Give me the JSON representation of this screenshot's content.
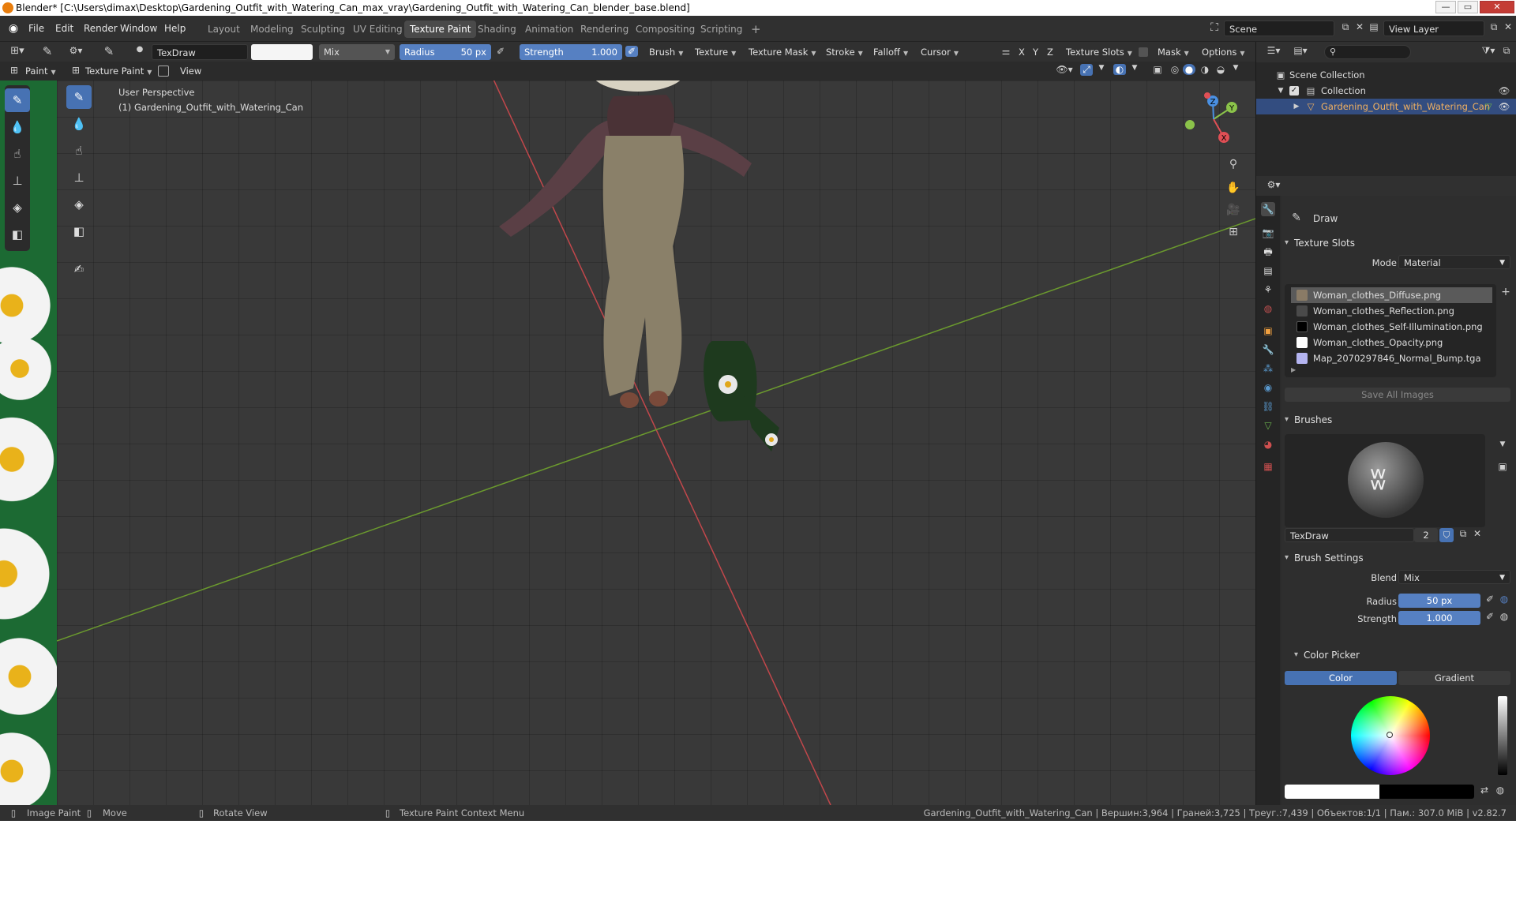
{
  "window": {
    "title": "Blender* [C:\\Users\\dimax\\Desktop\\Gardening_Outfit_with_Watering_Can_max_vray\\Gardening_Outfit_with_Watering_Can_blender_base.blend]",
    "minimize": "—",
    "maximize": "▭",
    "close": "✕"
  },
  "menu": {
    "items": [
      "File",
      "Edit",
      "Render",
      "Window",
      "Help"
    ]
  },
  "workspaces": [
    "Layout",
    "Modeling",
    "Sculpting",
    "UV Editing",
    "Texture Paint",
    "Shading",
    "Animation",
    "Rendering",
    "Compositing",
    "Scripting"
  ],
  "workspace_add": "+",
  "scene": {
    "label": "Scene",
    "view_layer": "View Layer"
  },
  "tool_header": {
    "brush_name": "TexDraw",
    "blend": "Mix",
    "radius_label": "Radius",
    "radius_value": "50 px",
    "strength_label": "Strength",
    "strength_value": "1.000",
    "menus": [
      "Brush",
      "Texture",
      "Texture Mask",
      "Stroke",
      "Falloff",
      "Cursor"
    ],
    "axes": [
      "X",
      "Y",
      "Z"
    ],
    "texture_slots": "Texture Slots",
    "mask": "Mask",
    "options": "Options"
  },
  "view_header": {
    "paint": "Paint",
    "mode": "Texture Paint",
    "view": "View"
  },
  "viewport": {
    "perspective": "User Perspective",
    "object": "(1) Gardening_Outfit_with_Watering_Can",
    "gizmo": {
      "x": "X",
      "y": "Y",
      "z": "Z"
    }
  },
  "outliner": {
    "scene_collection": "Scene Collection",
    "collection": "Collection",
    "object": "Gardening_Outfit_with_Watering_Can"
  },
  "properties": {
    "tool_name": "Draw",
    "texture_slots": {
      "title": "Texture Slots",
      "mode_label": "Mode",
      "mode_value": "Material",
      "slots": [
        {
          "name": "Woman_clothes_Diffuse.png",
          "color": "#8a7b66"
        },
        {
          "name": "Woman_clothes_Reflection.png",
          "color": "#4a4a4a"
        },
        {
          "name": "Woman_clothes_Self-Illumination.png",
          "color": "#000000"
        },
        {
          "name": "Woman_clothes_Opacity.png",
          "color": "#ffffff"
        },
        {
          "name": "Map_2070297846_Normal_Bump.tga",
          "color": "#b4b4f0"
        }
      ],
      "save_all": "Save All Images"
    },
    "brushes": {
      "title": "Brushes",
      "brush_name": "TexDraw",
      "users": "2"
    },
    "brush_settings": {
      "title": "Brush Settings",
      "blend_label": "Blend",
      "blend_value": "Mix",
      "radius_label": "Radius",
      "radius_value": "50 px",
      "strength_label": "Strength",
      "strength_value": "1.000"
    },
    "color_picker": {
      "title": "Color Picker",
      "color_tab": "Color",
      "gradient_tab": "Gradient"
    }
  },
  "status_bar": {
    "image_paint": "Image Paint",
    "move": "Move",
    "rotate_view": "Rotate View",
    "context_menu": "Texture Paint Context Menu",
    "stats": "Gardening_Outfit_with_Watering_Can | Вершин:3,964 | Граней:3,725 | Треуг.:7,439 | Объектов:1/1 | Пам.: 307.0 MiB | v2.82.7"
  },
  "colors": {
    "accent": "#4772b3",
    "slider": "#5680c2",
    "selected_object": "#f0b060",
    "x_axis": "#c2474b",
    "y_axis": "#6b9a2e"
  }
}
